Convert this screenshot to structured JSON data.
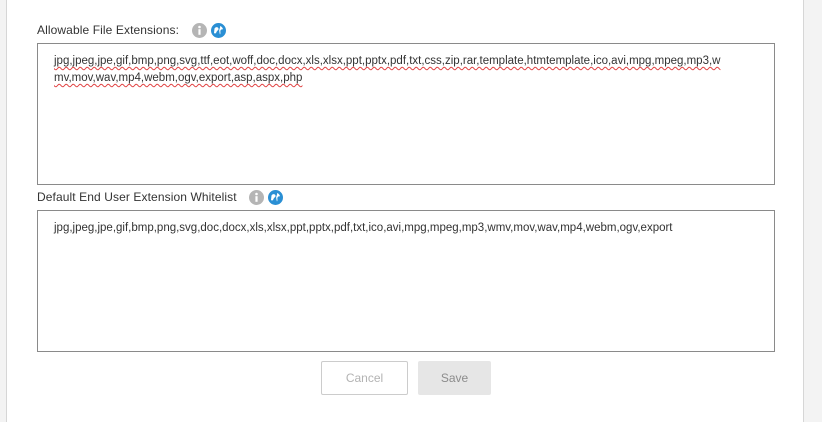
{
  "fields": {
    "allowable_extensions": {
      "label": "Allowable File Extensions:",
      "line1": "jpg,jpeg,jpe,gif,bmp,png,svg,ttf,eot,woff,doc,docx,xls,xlsx,ppt,pptx,pdf,txt,css,zip,rar,template,htmtemplate,ico,avi,mpg,mpeg,mp3,w",
      "line2": "mv,mov,wav,mp4,webm,ogv,export,asp,aspx,php"
    },
    "end_user_whitelist": {
      "label": "Default End User Extension Whitelist",
      "value": "jpg,jpeg,jpe,gif,bmp,png,svg,doc,docx,xls,xlsx,ppt,pptx,pdf,txt,ico,avi,mpg,mpeg,mp3,wmv,mov,wav,mp4,webm,ogv,export"
    }
  },
  "icons": {
    "info": "info-icon",
    "globe": "globe-icon"
  },
  "colors": {
    "info_icon": "#b5b5b5",
    "globe_icon": "#2a8fd4",
    "border": "#8a8a8a"
  },
  "buttons": {
    "cancel": "Cancel",
    "save": "Save"
  }
}
